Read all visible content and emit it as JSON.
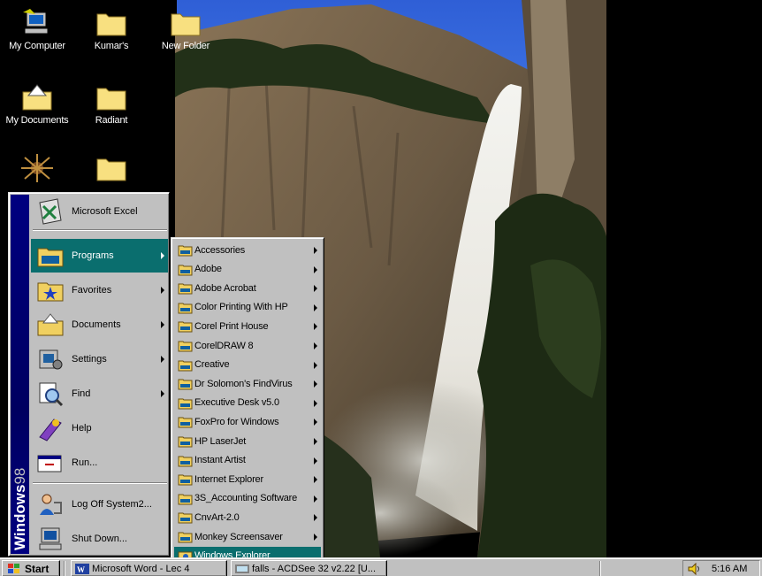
{
  "desktop": {
    "icons": [
      {
        "label": "My Computer",
        "icon": "my-computer-icon"
      },
      {
        "label": "Kumar's",
        "icon": "folder-icon"
      },
      {
        "label": "New Folder",
        "icon": "folder-icon"
      },
      {
        "label": "My Documents",
        "icon": "my-documents-icon"
      },
      {
        "label": "Radiant",
        "icon": "folder-icon"
      },
      {
        "label": "",
        "icon": "network-neighborhood-icon"
      },
      {
        "label": "",
        "icon": "folder-icon"
      }
    ]
  },
  "start_menu": {
    "banner": {
      "bold": "Windows",
      "thin": "98"
    },
    "items": [
      {
        "label": "Microsoft Excel",
        "icon": "excel-icon",
        "submenu": false
      },
      {
        "label": "Programs",
        "icon": "programs-icon",
        "submenu": true,
        "selected": true
      },
      {
        "label": "Favorites",
        "icon": "favorites-icon",
        "submenu": true
      },
      {
        "label": "Documents",
        "icon": "documents-icon",
        "submenu": true
      },
      {
        "label": "Settings",
        "icon": "settings-icon",
        "submenu": true
      },
      {
        "label": "Find",
        "icon": "find-icon",
        "submenu": true
      },
      {
        "label": "Help",
        "icon": "help-icon",
        "submenu": false
      },
      {
        "label": "Run...",
        "icon": "run-icon",
        "submenu": false
      },
      {
        "label": "Log Off System2...",
        "icon": "log-off-icon",
        "submenu": false
      },
      {
        "label": "Shut Down...",
        "icon": "shut-down-icon",
        "submenu": false
      }
    ]
  },
  "programs_menu": {
    "items": [
      {
        "label": "Accessories",
        "submenu": true
      },
      {
        "label": "Adobe",
        "submenu": true
      },
      {
        "label": "Adobe Acrobat",
        "submenu": true
      },
      {
        "label": "Color Printing With HP",
        "submenu": true
      },
      {
        "label": "Corel Print House",
        "submenu": true
      },
      {
        "label": "CorelDRAW 8",
        "submenu": true
      },
      {
        "label": "Creative",
        "submenu": true
      },
      {
        "label": "Dr Solomon's FindVirus",
        "submenu": true
      },
      {
        "label": "Executive Desk v5.0",
        "submenu": true
      },
      {
        "label": "FoxPro for Windows",
        "submenu": true
      },
      {
        "label": "HP LaserJet",
        "submenu": true
      },
      {
        "label": "Instant Artist",
        "submenu": true
      },
      {
        "label": "Internet Explorer",
        "submenu": true
      },
      {
        "label": "3S_Accounting Software",
        "submenu": true
      },
      {
        "label": "CnvArt-2.0",
        "submenu": true
      },
      {
        "label": "Monkey Screensaver",
        "submenu": true
      },
      {
        "label": "Windows Explorer",
        "submenu": false,
        "selected": true
      }
    ]
  },
  "taskbar": {
    "start_label": "Start",
    "tasks": [
      {
        "label": "Microsoft Word - Lec 4",
        "icon": "word-icon"
      },
      {
        "label": "falls - ACDSee 32 v2.22 [U...",
        "icon": "acdsee-icon"
      }
    ],
    "clock": "5:16 AM",
    "tray_icon": "speaker-icon"
  },
  "colors": {
    "menu_face": "#c0c0c0",
    "highlight": "#0a6e6e",
    "banner": "#000080"
  }
}
